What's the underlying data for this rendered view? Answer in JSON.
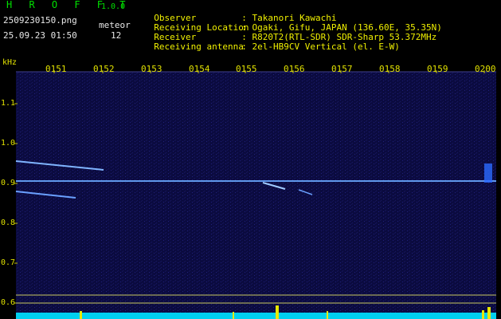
{
  "header": {
    "brand": "H R O F F T",
    "version": "1.0.0",
    "filename": "2509230150.png",
    "meteor_label": "meteor",
    "datetime": "25.09.23 01:50",
    "meteor_count": "12"
  },
  "info": {
    "observer_key": "Observer",
    "observer_val": ": Takanori Kawachi",
    "location_key": "Receiving Location",
    "location_val": ": Ogaki, Gifu, JAPAN (136.60E, 35.35N)",
    "receiver_key": "Receiver",
    "receiver_val": ": R820T2(RTL-SDR) SDR-Sharp 53.372MHz",
    "antenna_key": "Receiving antenna",
    "antenna_val": ": 2el-HB9CV Vertical (el. E-W)"
  },
  "axis": {
    "unit": "kHz",
    "time_labels": [
      "0151",
      "0152",
      "0153",
      "0154",
      "0155",
      "0156",
      "0157",
      "0158",
      "0159",
      "0200"
    ],
    "freq_labels": [
      "1.1",
      "1.0",
      "0.9",
      "0.8",
      "0.7",
      "0.6"
    ]
  },
  "colors": {
    "background": "#000000",
    "spectrogram_bg": "#0a0a3a",
    "signal": "#5fa0ff",
    "header_text": "#f0f000",
    "brand_text": "#00e000",
    "bottom_trace": "#00d8ff"
  }
}
